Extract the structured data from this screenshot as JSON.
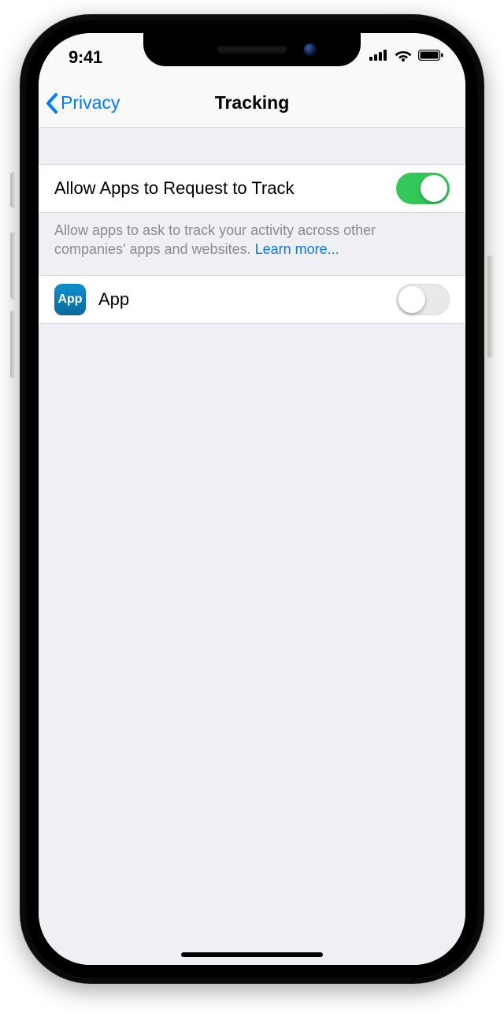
{
  "statusbar": {
    "time": "9:41"
  },
  "nav": {
    "back_label": "Privacy",
    "title": "Tracking"
  },
  "settings": {
    "allow_request_label": "Allow Apps to Request to Track",
    "allow_request_on": true,
    "footnote_text": "Allow apps to ask to track your activity across other companies' apps and websites. ",
    "footnote_link": "Learn more...",
    "apps": [
      {
        "icon_text": "App",
        "name": "App",
        "tracking_on": false
      }
    ]
  }
}
